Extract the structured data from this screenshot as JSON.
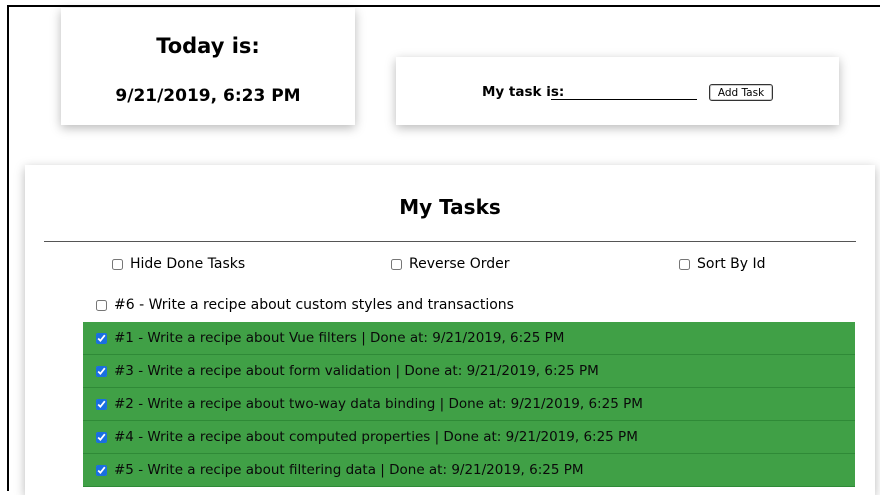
{
  "date_card": {
    "title": "Today is:",
    "date": "9/21/2019, 6:23 PM"
  },
  "task_card": {
    "label": "My task is:",
    "input_value": "",
    "add_button": "Add Task"
  },
  "list": {
    "heading": "My Tasks",
    "filters": [
      {
        "label": "Hide Done Tasks",
        "checked": false
      },
      {
        "label": "Reverse Order",
        "checked": false
      },
      {
        "label": "Sort By Id",
        "checked": false
      }
    ],
    "open_tasks": [
      {
        "text": "#6 - Write a recipe about custom styles and transactions",
        "checked": false
      }
    ],
    "done_tasks": [
      {
        "text": "#1 - Write a recipe about Vue filters | Done at: 9/21/2019, 6:25 PM",
        "checked": true
      },
      {
        "text": "#3 - Write a recipe about form validation | Done at: 9/21/2019, 6:25 PM",
        "checked": true
      },
      {
        "text": "#2 - Write a recipe about two-way data binding | Done at: 9/21/2019, 6:25 PM",
        "checked": true
      },
      {
        "text": "#4 - Write a recipe about computed properties | Done at: 9/21/2019, 6:25 PM",
        "checked": true
      },
      {
        "text": "#5 - Write a recipe about filtering data | Done at: 9/21/2019, 6:25 PM",
        "checked": true
      }
    ],
    "done_color": "#40a046"
  }
}
